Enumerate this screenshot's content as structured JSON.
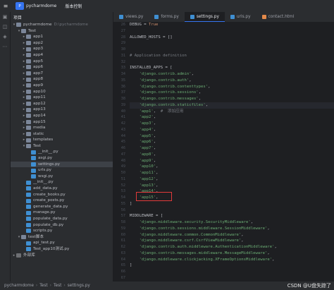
{
  "titlebar": {
    "menu_icon": "hamburger-menu-icon",
    "project_badge": "P",
    "project_name": "pycharmdome",
    "vcs_label": "版本控制"
  },
  "tool_window_icons": [
    "folder-icon",
    "structure-icon",
    "plugin-icon",
    "more-icon"
  ],
  "project_panel": {
    "title": "项目",
    "tree": [
      {
        "label": "pycharmdome",
        "suffix": "D:\\pycharmdome",
        "indent": 0,
        "type": "folder",
        "arrow": "▾"
      },
      {
        "label": "Test",
        "indent": 1,
        "type": "folder",
        "arrow": "▾"
      },
      {
        "label": "app1",
        "indent": 2,
        "type": "folder",
        "arrow": "▸"
      },
      {
        "label": "app2",
        "indent": 2,
        "type": "folder",
        "arrow": "▸"
      },
      {
        "label": "app3",
        "indent": 2,
        "type": "folder",
        "arrow": "▸"
      },
      {
        "label": "app4",
        "indent": 2,
        "type": "folder",
        "arrow": "▸"
      },
      {
        "label": "app5",
        "indent": 2,
        "type": "folder",
        "arrow": "▸"
      },
      {
        "label": "app6",
        "indent": 2,
        "type": "folder",
        "arrow": "▸"
      },
      {
        "label": "app7",
        "indent": 2,
        "type": "folder",
        "arrow": "▸"
      },
      {
        "label": "app8",
        "indent": 2,
        "type": "folder",
        "arrow": "▸"
      },
      {
        "label": "app9",
        "indent": 2,
        "type": "folder",
        "arrow": "▸"
      },
      {
        "label": "app10",
        "indent": 2,
        "type": "folder",
        "arrow": "▸"
      },
      {
        "label": "app11",
        "indent": 2,
        "type": "folder",
        "arrow": "▸"
      },
      {
        "label": "app12",
        "indent": 2,
        "type": "folder",
        "arrow": "▸"
      },
      {
        "label": "app13",
        "indent": 2,
        "type": "folder",
        "arrow": "▸"
      },
      {
        "label": "app14",
        "indent": 2,
        "type": "folder",
        "arrow": "▸"
      },
      {
        "label": "app15",
        "indent": 2,
        "type": "folder",
        "arrow": "▸"
      },
      {
        "label": "media",
        "indent": 2,
        "type": "folder",
        "arrow": "▸"
      },
      {
        "label": "static",
        "indent": 2,
        "type": "folder",
        "arrow": "▸"
      },
      {
        "label": "templates",
        "indent": 2,
        "type": "folder",
        "arrow": "▸"
      },
      {
        "label": "Test",
        "indent": 2,
        "type": "folder",
        "arrow": "▾"
      },
      {
        "label": "__init__.py",
        "indent": 3,
        "type": "py",
        "arrow": ""
      },
      {
        "label": "asgi.py",
        "indent": 3,
        "type": "py",
        "arrow": ""
      },
      {
        "label": "settings.py",
        "indent": 3,
        "type": "py",
        "arrow": "",
        "selected": true
      },
      {
        "label": "urls.py",
        "indent": 3,
        "type": "py",
        "arrow": ""
      },
      {
        "label": "wsgi.py",
        "indent": 3,
        "type": "py",
        "arrow": ""
      },
      {
        "label": "__init__.py",
        "indent": 2,
        "type": "py",
        "arrow": ""
      },
      {
        "label": "add_data.py",
        "indent": 2,
        "type": "py",
        "arrow": ""
      },
      {
        "label": "create_books.py",
        "indent": 2,
        "type": "py",
        "arrow": ""
      },
      {
        "label": "create_posts.py",
        "indent": 2,
        "type": "py",
        "arrow": ""
      },
      {
        "label": "generate_data.py",
        "indent": 2,
        "type": "py",
        "arrow": ""
      },
      {
        "label": "manage.py",
        "indent": 2,
        "type": "py",
        "arrow": ""
      },
      {
        "label": "populate_data.py",
        "indent": 2,
        "type": "py",
        "arrow": ""
      },
      {
        "label": "populate_db.py",
        "indent": 2,
        "type": "py",
        "arrow": ""
      },
      {
        "label": "scripts.py",
        "indent": 2,
        "type": "py",
        "arrow": ""
      },
      {
        "label": "test脚本",
        "indent": 1,
        "type": "folder",
        "arrow": "▾"
      },
      {
        "label": "api_test.py",
        "indent": 2,
        "type": "py",
        "arrow": ""
      },
      {
        "label": "Test_app10测试.py",
        "indent": 2,
        "type": "py",
        "arrow": ""
      },
      {
        "label": "外部库",
        "indent": 0,
        "type": "lib",
        "arrow": "▸"
      }
    ]
  },
  "tabs": [
    {
      "label": "views.py",
      "icon": "python-file-icon",
      "active": false
    },
    {
      "label": "forms.py",
      "icon": "python-file-icon",
      "active": false
    },
    {
      "label": "settings.py",
      "icon": "python-file-icon",
      "active": true
    },
    {
      "label": "urls.py",
      "icon": "python-file-icon",
      "active": false
    },
    {
      "label": "contact.html",
      "icon": "html-file-icon",
      "active": false
    }
  ],
  "editor": {
    "line_numbers": [
      "26",
      "27",
      "28",
      "29",
      "30",
      "31",
      "32",
      "33",
      "34",
      "35",
      "36",
      "37",
      "38",
      "39",
      "40",
      "41",
      "42",
      "43",
      "44",
      "45",
      "46",
      "47",
      "48",
      "49",
      "50",
      "51",
      "52",
      "53",
      "54",
      "55",
      "56",
      "57",
      "58",
      "59",
      "60",
      "61",
      "62",
      "63",
      "64",
      "65",
      "66",
      "67"
    ],
    "lines": [
      [
        {
          "t": "DEBUG = ",
          "c": ""
        },
        {
          "t": "True",
          "c": "k"
        }
      ],
      [],
      [
        {
          "t": "ALLOWED_HOSTS = []",
          "c": ""
        }
      ],
      [],
      [],
      [
        {
          "t": "# Application definition",
          "c": "c"
        }
      ],
      [],
      [
        {
          "t": "INSTALLED_APPS = [",
          "c": ""
        }
      ],
      [
        {
          "t": "    ",
          "c": ""
        },
        {
          "t": "'django.contrib.admin'",
          "c": "s"
        },
        {
          "t": ",",
          "c": ""
        }
      ],
      [
        {
          "t": "    ",
          "c": ""
        },
        {
          "t": "'django.contrib.auth'",
          "c": "s"
        },
        {
          "t": ",",
          "c": ""
        }
      ],
      [
        {
          "t": "    ",
          "c": ""
        },
        {
          "t": "'django.contrib.contenttypes'",
          "c": "s"
        },
        {
          "t": ",",
          "c": ""
        }
      ],
      [
        {
          "t": "    ",
          "c": ""
        },
        {
          "t": "'django.contrib.sessions'",
          "c": "s"
        },
        {
          "t": ",",
          "c": ""
        }
      ],
      [
        {
          "t": "    ",
          "c": ""
        },
        {
          "t": "'django.contrib.messages'",
          "c": "s"
        },
        {
          "t": ",",
          "c": ""
        }
      ],
      [
        {
          "t": "    ",
          "c": ""
        },
        {
          "t": "'django.contrib.staticfiles'",
          "c": "s"
        },
        {
          "t": ",",
          "c": ""
        }
      ],
      [
        {
          "t": "    ",
          "c": ""
        },
        {
          "t": "'app1'",
          "c": "s"
        },
        {
          "t": ",  ",
          "c": ""
        },
        {
          "t": "#  添加应用",
          "c": "c"
        }
      ],
      [
        {
          "t": "    ",
          "c": ""
        },
        {
          "t": "'app2'",
          "c": "s"
        },
        {
          "t": ",",
          "c": ""
        }
      ],
      [
        {
          "t": "    ",
          "c": ""
        },
        {
          "t": "'app3'",
          "c": "s"
        },
        {
          "t": ",",
          "c": ""
        }
      ],
      [
        {
          "t": "    ",
          "c": ""
        },
        {
          "t": "'app4'",
          "c": "s"
        },
        {
          "t": ",",
          "c": ""
        }
      ],
      [
        {
          "t": "    ",
          "c": ""
        },
        {
          "t": "'app5'",
          "c": "s"
        },
        {
          "t": ",",
          "c": ""
        }
      ],
      [
        {
          "t": "    ",
          "c": ""
        },
        {
          "t": "'app6'",
          "c": "s"
        },
        {
          "t": ",",
          "c": ""
        }
      ],
      [
        {
          "t": "    ",
          "c": ""
        },
        {
          "t": "'app7'",
          "c": "s"
        },
        {
          "t": ",",
          "c": ""
        }
      ],
      [
        {
          "t": "    ",
          "c": ""
        },
        {
          "t": "'app8'",
          "c": "s"
        },
        {
          "t": ",",
          "c": ""
        }
      ],
      [
        {
          "t": "    ",
          "c": ""
        },
        {
          "t": "'app9'",
          "c": "s"
        },
        {
          "t": ",",
          "c": ""
        }
      ],
      [
        {
          "t": "    ",
          "c": ""
        },
        {
          "t": "'app10'",
          "c": "s"
        },
        {
          "t": ",",
          "c": ""
        }
      ],
      [
        {
          "t": "    ",
          "c": ""
        },
        {
          "t": "'app11'",
          "c": "s"
        },
        {
          "t": ",",
          "c": ""
        }
      ],
      [
        {
          "t": "    ",
          "c": ""
        },
        {
          "t": "'app12'",
          "c": "s"
        },
        {
          "t": ",",
          "c": ""
        }
      ],
      [
        {
          "t": "    ",
          "c": ""
        },
        {
          "t": "'app13'",
          "c": "s"
        },
        {
          "t": ",",
          "c": ""
        }
      ],
      [
        {
          "t": "    ",
          "c": ""
        },
        {
          "t": "'app14'",
          "c": "s"
        },
        {
          "t": ",",
          "c": ""
        }
      ],
      [
        {
          "t": "    ",
          "c": ""
        },
        {
          "t": "'app15'",
          "c": "s"
        },
        {
          "t": ",",
          "c": ""
        }
      ],
      [
        {
          "t": "]",
          "c": ""
        }
      ],
      [],
      [
        {
          "t": "MIDDLEWARE = [",
          "c": ""
        }
      ],
      [
        {
          "t": "    ",
          "c": ""
        },
        {
          "t": "'django.middleware.security.SecurityMiddleware'",
          "c": "s"
        },
        {
          "t": ",",
          "c": ""
        }
      ],
      [
        {
          "t": "    ",
          "c": ""
        },
        {
          "t": "'django.contrib.sessions.middleware.SessionMiddleware'",
          "c": "s"
        },
        {
          "t": ",",
          "c": ""
        }
      ],
      [
        {
          "t": "    ",
          "c": ""
        },
        {
          "t": "'django.middleware.common.CommonMiddleware'",
          "c": "s"
        },
        {
          "t": ",",
          "c": ""
        }
      ],
      [
        {
          "t": "    ",
          "c": ""
        },
        {
          "t": "'django.middleware.csrf.CsrfViewMiddleware'",
          "c": "s"
        },
        {
          "t": ",",
          "c": ""
        }
      ],
      [
        {
          "t": "    ",
          "c": ""
        },
        {
          "t": "'django.contrib.auth.middleware.AuthenticationMiddleware'",
          "c": "s"
        },
        {
          "t": ",",
          "c": ""
        }
      ],
      [
        {
          "t": "    ",
          "c": ""
        },
        {
          "t": "'django.contrib.messages.middleware.MessageMiddleware'",
          "c": "s"
        },
        {
          "t": ",",
          "c": ""
        }
      ],
      [
        {
          "t": "    ",
          "c": ""
        },
        {
          "t": "'django.middleware.clickjacking.XFrameOptionsMiddleware'",
          "c": "s"
        },
        {
          "t": ",",
          "c": ""
        }
      ],
      [
        {
          "t": "]",
          "c": ""
        }
      ],
      [],
      []
    ],
    "highlighted_line_index": 13
  },
  "statusbar": {
    "breadcrumb": [
      "pycharmdome",
      "Test",
      "Test",
      "settings.py"
    ]
  },
  "watermark": "CSDN @U盘失踪了",
  "colors": {
    "accent": "#3574f0",
    "highlight_box": "#e23a3a"
  }
}
